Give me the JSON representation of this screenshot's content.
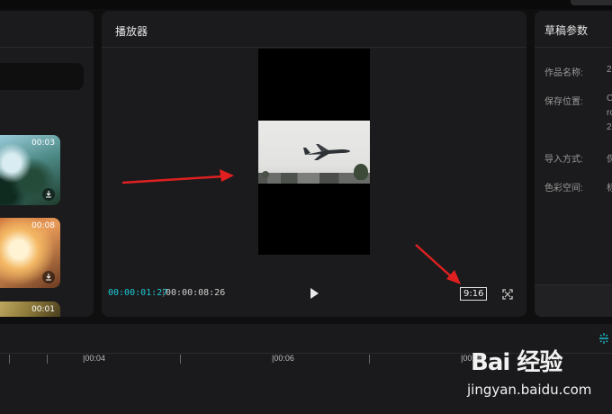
{
  "player": {
    "title": "播放器",
    "current_time": "00:00:01:27",
    "separator": "|",
    "total_time": "00:00:08:26",
    "aspect_ratio": "9:16"
  },
  "media": {
    "items": [
      {
        "duration": "00:03"
      },
      {
        "duration": "00:08"
      },
      {
        "duration": "00:01"
      }
    ]
  },
  "params": {
    "title": "草稿参数",
    "rows": [
      {
        "label": "作品名称:",
        "value": "2"
      },
      {
        "label": "保存位置:",
        "value": "C"
      },
      {
        "label": "导入方式:",
        "value": "保"
      },
      {
        "label": "色彩空间:",
        "value": "标"
      }
    ],
    "path_lines": [
      "ro",
      "2"
    ]
  },
  "timeline": {
    "ticks": [
      "|00:04",
      "|00:06",
      "|00:08"
    ]
  },
  "watermark": {
    "logo": "Bai 经验",
    "url": "jingyan.baidu.com"
  },
  "colors": {
    "accent": "#1ec9d8",
    "annotation": "#e02020"
  }
}
